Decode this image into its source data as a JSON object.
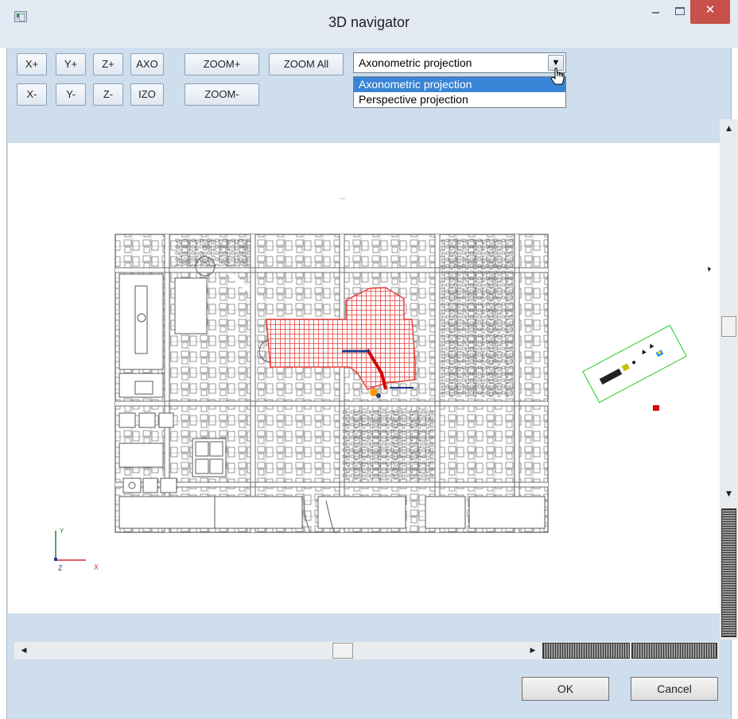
{
  "window": {
    "title": "3D navigator",
    "close_glyph": "✕"
  },
  "toolbar": {
    "x_plus": "X+",
    "y_plus": "Y+",
    "z_plus": "Z+",
    "axo": "AXO",
    "x_minus": "X-",
    "y_minus": "Y-",
    "z_minus": "Z-",
    "izo": "IZO",
    "zoom_in": "ZOOM+",
    "zoom_out": "ZOOM-",
    "zoom_all": "ZOOM All"
  },
  "projection": {
    "selected": "Axonometric projection",
    "options": [
      "Axonometric projection",
      "Perspective projection"
    ],
    "highlighted_index": 0
  },
  "axes": {
    "x_label": "X",
    "y_label": "Y",
    "z_label": "Z"
  },
  "scrollbars": {
    "up_glyph": "▲",
    "down_glyph": "▼",
    "left_glyph": "◀",
    "right_glyph": "▶"
  },
  "buttons": {
    "ok": "OK",
    "cancel": "Cancel"
  },
  "colors": {
    "dialog_bg": "#cfdeed",
    "close_button": "#c7504a",
    "highlight": "#3a84d6",
    "hatch_region": "#e53935",
    "axis_x": "#d32f2f",
    "axis_y": "#2e7d32",
    "axis_z": "#1e3a8a",
    "detail_frame": "#22cc22"
  }
}
